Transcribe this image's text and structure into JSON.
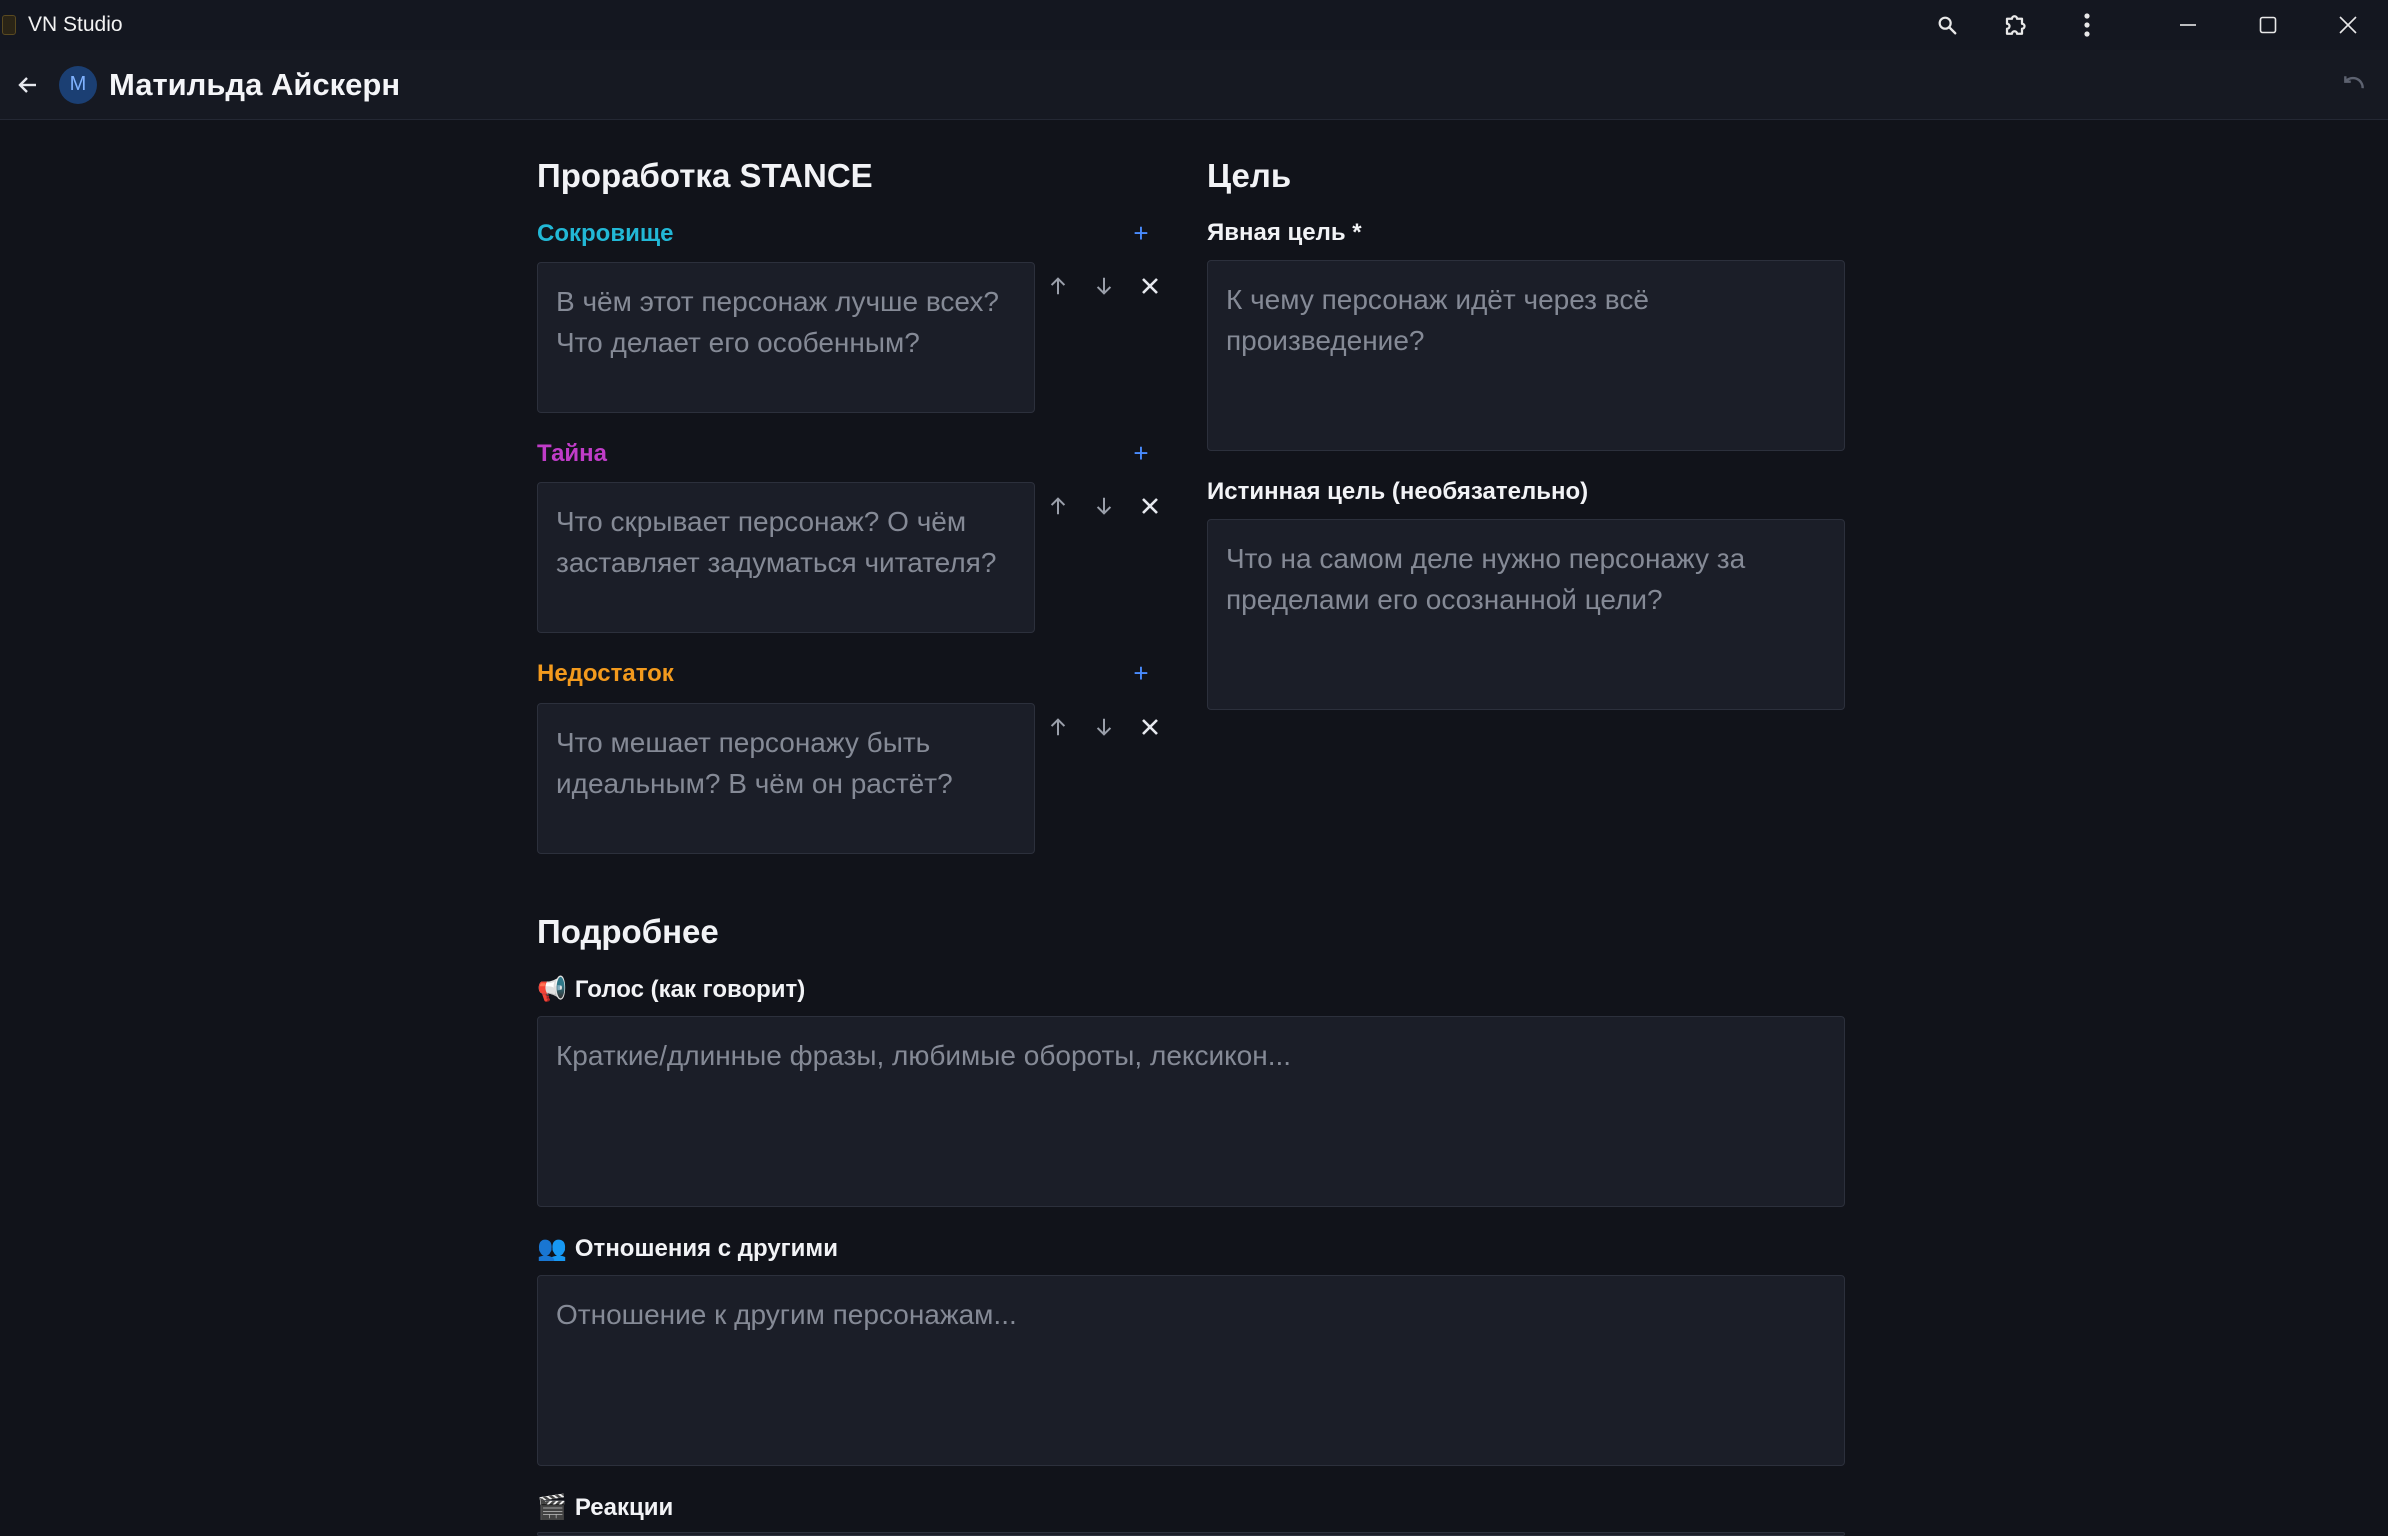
{
  "window": {
    "title": "VN Studio"
  },
  "header": {
    "avatar_letter": "M",
    "character_name": "Матильда Айскерн"
  },
  "stance": {
    "title": "Проработка STANCE",
    "items": [
      {
        "label": "Сокровище",
        "color": "#22b8d6",
        "placeholder": "В чём этот персонаж лучше всех? Что делает его особенным?"
      },
      {
        "label": "Тайна",
        "color": "#c03cc8",
        "placeholder": "Что скрывает персонаж? О чём заставляет задуматься читателя?"
      },
      {
        "label": "Недостаток",
        "color": "#f39a1d",
        "placeholder": "Что мешает персонажу быть идеальным? В чём он растёт?"
      }
    ],
    "add_symbol": "+"
  },
  "goal": {
    "title": "Цель",
    "explicit_label": "Явная цель *",
    "explicit_placeholder": "К чему персонаж идёт через всё произведение?",
    "true_label": "Истинная цель (необязательно)",
    "true_placeholder": "Что на самом деле нужно персонажу за пределами его осознанной цели?"
  },
  "details": {
    "title": "Подробнее",
    "voice_emoji": "📢",
    "voice_label": "Голос (как говорит)",
    "voice_placeholder": "Краткие/длинные фразы, любимые обороты, лексикон...",
    "relations_emoji": "👥",
    "relations_label": "Отношения с другими",
    "relations_placeholder": "Отношение к другим персонажам...",
    "reactions_emoji": "🎬",
    "reactions_label": "Реакции"
  },
  "icons": [
    "search-icon",
    "extension-icon",
    "more-vert-icon",
    "minimize-icon",
    "maximize-icon",
    "close-icon",
    "back-arrow-icon",
    "undo-icon",
    "arrow-up-icon",
    "arrow-down-icon",
    "remove-icon"
  ]
}
